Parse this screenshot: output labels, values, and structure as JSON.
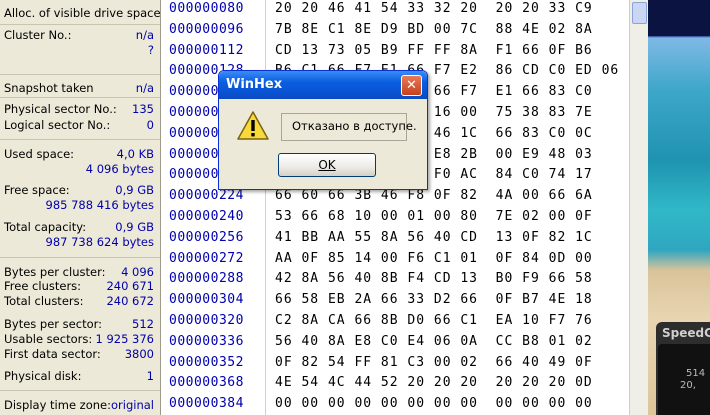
{
  "info_panel": {
    "rows": [
      {
        "label": "Alloc. of visible drive space:",
        "value": ""
      },
      {
        "label": "Cluster No.:",
        "value": "n/a"
      },
      {
        "label": "",
        "value": "?"
      },
      {
        "label": "Snapshot taken",
        "value": "n/a"
      },
      {
        "label": "Physical sector No.:",
        "value": "135"
      },
      {
        "label": "Logical sector No.:",
        "value": "0"
      },
      {
        "label": "Used space:",
        "value": "4,0 KB"
      },
      {
        "label": "",
        "value": "4 096 bytes"
      },
      {
        "label": "Free space:",
        "value": "0,9 GB"
      },
      {
        "label": "",
        "value": "985 788 416 bytes"
      },
      {
        "label": "Total capacity:",
        "value": "0,9 GB"
      },
      {
        "label": "",
        "value": "987 738 624 bytes"
      },
      {
        "label": "Bytes per cluster:",
        "value": "4 096"
      },
      {
        "label": "Free clusters:",
        "value": "240 671"
      },
      {
        "label": "Total clusters:",
        "value": "240 672"
      },
      {
        "label": "Bytes per sector:",
        "value": "512"
      },
      {
        "label": "Usable sectors:",
        "value": "1 925 376"
      },
      {
        "label": "First data sector:",
        "value": "3800"
      },
      {
        "label": "Physical disk:",
        "value": "1"
      },
      {
        "label": "Display time zone:",
        "value": "original"
      }
    ]
  },
  "hex_view": {
    "offsets": [
      "000000080",
      "000000096",
      "000000112",
      "000000128",
      "000000144",
      "000000160",
      "000000176",
      "000000192",
      "000000208",
      "000000224",
      "000000240",
      "000000256",
      "000000272",
      "000000288",
      "000000304",
      "000000320",
      "000000336",
      "000000352",
      "000000368",
      "000000384"
    ],
    "rows": [
      "20 20 46 41 54 33 32 20  20 20 33 C9",
      "7B 8E C1 8E D9 BD 00 7C  88 4E 02 8A",
      "CD 13 73 05 B9 FF FF 8A  F1 66 0F B6",
      "B6 C1 66 F7 E1 66 F7 E2  86 CD C0 ED 06",
      "41 66 0F B7 49 18 66 F7  E1 66 83 C0",
      "66 89 46 F8 83 7E 16 00  75 38 83 7E",
      "2A 00 77 32 66 8B 46 1C  66 83 C0 0C",
      "BB 00 80 B9 01 00 E8 2B  00 E9 48 03",
      "A0 FA 7D B4 7D 8B F0 AC  84 C0 74 17",
      "66 60 66 3B 46 F8 0F 82  4A 00 66 6A",
      "53 66 68 10 00 01 00 80  7E 02 00 0F",
      "41 BB AA 55 8A 56 40 CD  13 0F 82 1C",
      "AA 0F 85 14 00 F6 C1 01  0F 84 0D 00",
      "42 8A 56 40 8B F4 CD 13  B0 F9 66 58",
      "66 58 EB 2A 66 33 D2 66  0F B7 4E 18",
      "C2 8A CA 66 8B D0 66 C1  EA 10 F7 76",
      "56 40 8A E8 C0 E4 06 0A  CC B8 01 02",
      "0F 82 54 FF 81 C3 00 02  66 40 49 0F",
      "4E 54 4C 44 52 20 20 20  20 20 20 0D",
      "00 00 00 00 00 00 00 00  00 00 00 00"
    ]
  },
  "dialog": {
    "title": "WinHex",
    "message": "Отказано в доступе.",
    "ok_label": "OK",
    "icon": "warning-icon"
  },
  "taskbar_widget": {
    "title": "SpeedC",
    "line1": "514",
    "line2": "20,"
  }
}
